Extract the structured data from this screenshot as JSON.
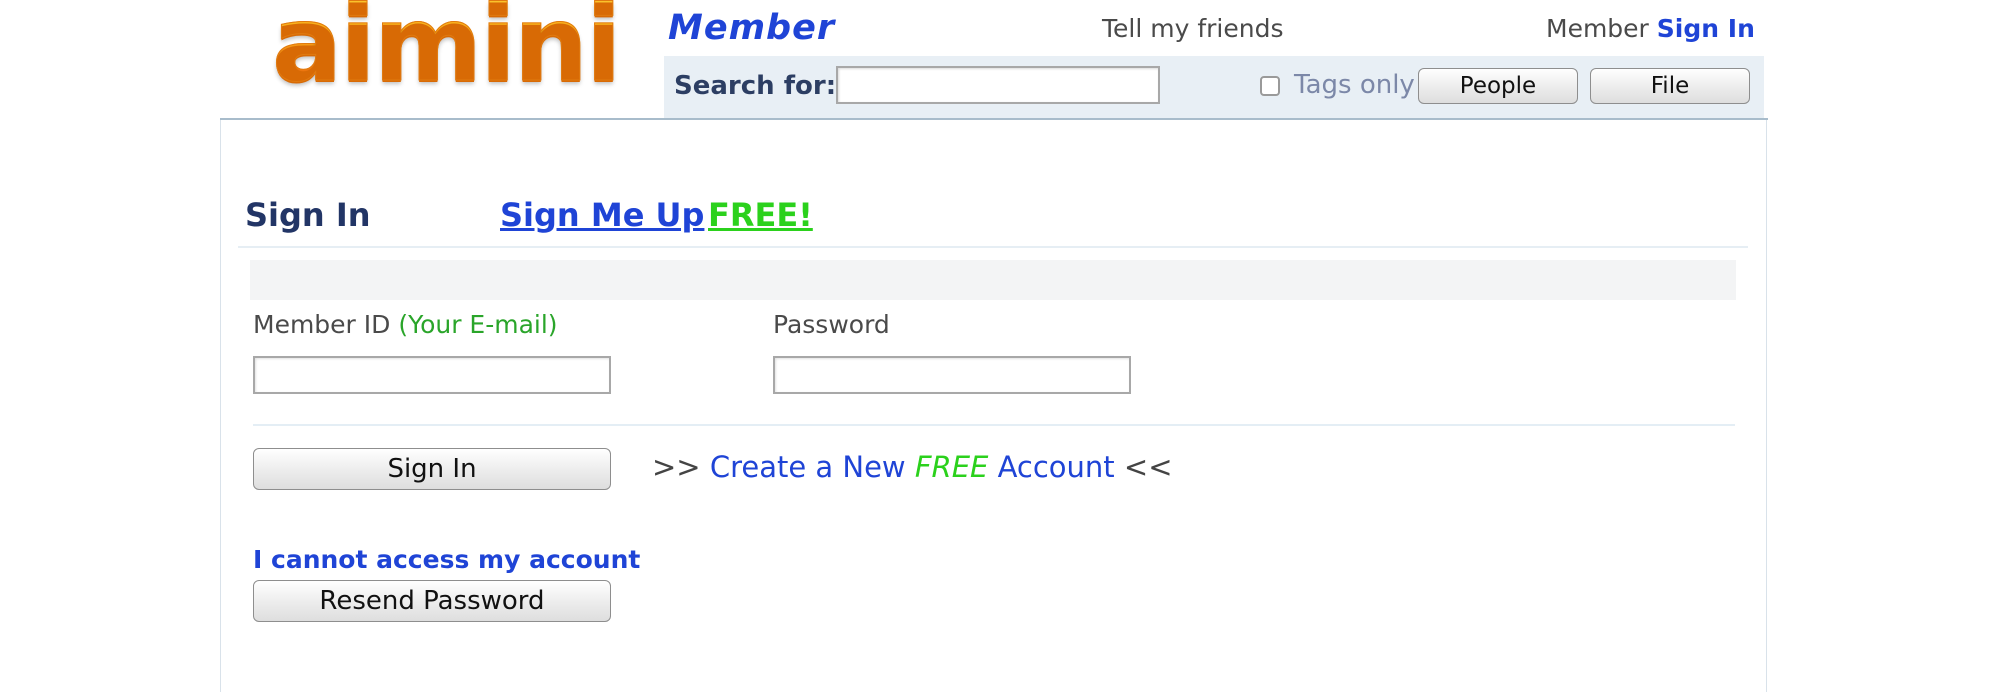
{
  "header": {
    "logo_text": "aimini",
    "section_title": "Member",
    "tell_friends": "Tell my friends",
    "member_prefix": "Member",
    "member_signin": "Sign In"
  },
  "search": {
    "label": "Search for:",
    "value": "",
    "tags_only_label": "Tags only",
    "tags_only_checked": false,
    "people_button": "People",
    "file_button": "File"
  },
  "tabs": {
    "signin": "Sign In",
    "signup": "Sign Me Up",
    "free": "FREE!"
  },
  "form": {
    "member_id_label": "Member ID",
    "member_id_hint": "(Your E-mail)",
    "member_id_value": "",
    "password_label": "Password",
    "password_value": "",
    "signin_button": "Sign In",
    "create_prefix": ">>",
    "create_text_1": "Create a New",
    "create_text_free": "FREE",
    "create_text_2": "Account",
    "create_suffix": "<<",
    "cannot_access": "I cannot access my account",
    "resend_button": "Resend Password"
  },
  "colors": {
    "link_blue": "#1f44d6",
    "free_green": "#2bd11c",
    "hint_green": "#2aa52a",
    "logo_orange": "#f58a12",
    "search_bar_bg": "#e8eff5"
  }
}
